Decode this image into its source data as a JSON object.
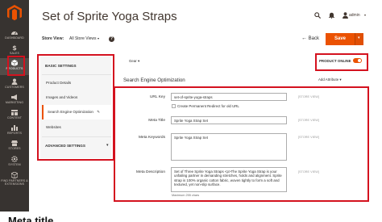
{
  "nav": {
    "items": [
      {
        "label": "DASHBOARD",
        "icon": "dashboard-icon"
      },
      {
        "label": "SALES",
        "icon": "dollar-icon"
      },
      {
        "label": "PRODUCTS",
        "icon": "box-icon"
      },
      {
        "label": "CUSTOMERS",
        "icon": "customer-icon"
      },
      {
        "label": "MARKETING",
        "icon": "megaphone-icon"
      },
      {
        "label": "CONTENT",
        "icon": "layout-icon"
      },
      {
        "label": "REPORTS",
        "icon": "bar-chart-icon"
      },
      {
        "label": "STORES",
        "icon": "store-icon"
      },
      {
        "label": "SYSTEM",
        "icon": "gear-icon"
      },
      {
        "label": "FIND PARTNERS & EXTENSIONS",
        "icon": "cube-icon"
      }
    ],
    "active": "PRODUCTS"
  },
  "header": {
    "title": "Set of Sprite Yoga Straps",
    "admin_user": "admin"
  },
  "scope": {
    "label": "Store View:",
    "value": "All Store Views"
  },
  "actions": {
    "back_label": "Back",
    "save_label": "Save"
  },
  "tabs": {
    "basic_heading": "BASIC SETTINGS",
    "items": [
      "Product Details",
      "Images and Videos",
      "Search Engine Optimization",
      "Websites"
    ],
    "active_index": 2,
    "advanced_heading": "ADVANCED SETTINGS"
  },
  "content": {
    "gear_label": "Gear",
    "product_online_label": "PRODUCT ONLINE",
    "product_online": true,
    "section_title": "Search Engine Optimization",
    "add_attribute_label": "Add Attribute",
    "fields": {
      "url_key": {
        "label": "URL Key",
        "value": "set-of-sprite-yoga-straps",
        "scope": "[STORE VIEW]"
      },
      "redirect": {
        "label": "Create Permanent Redirect for old URL"
      },
      "meta_title": {
        "label": "Meta Title",
        "value": "Sprite Yoga Strap Set",
        "scope": "[STORE VIEW]"
      },
      "meta_keywords": {
        "label": "Meta Keywords",
        "value": "Sprite Yoga Strap Set",
        "scope": "[STORE VIEW]"
      },
      "meta_description": {
        "label": "Meta Description",
        "value": "Set of Three Sprite Yoga Straps <p>The Sprite Yoga Strap is your unfailing partner in demanding stretches, holds and alignment. Sprite strap is 100% organic cotton fabric, woven tightly to form a soft and textured, yet non-slip surface.",
        "scope": "[STORE VIEW]",
        "hint": "Maximum 255 chars"
      }
    }
  },
  "caption": "Meta title",
  "colors": {
    "nav_bg": "#373330",
    "accent": "#eb5202",
    "highlight_box": "#d4121f"
  }
}
